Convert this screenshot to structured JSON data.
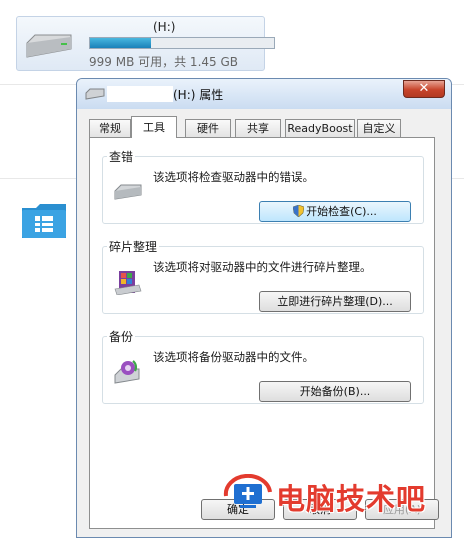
{
  "explorer": {
    "drive_title": "(H:)",
    "drive_capacity": "999 MB 可用，共 1.45 GB",
    "usage_fraction": 0.33
  },
  "dialog": {
    "title": "(H:) 属性",
    "close_label": "✕",
    "tabs": [
      {
        "label": "常规",
        "active": false
      },
      {
        "label": "工具",
        "active": true
      },
      {
        "label": "硬件",
        "active": false
      },
      {
        "label": "共享",
        "active": false
      },
      {
        "label": "ReadyBoost",
        "active": false
      },
      {
        "label": "自定义",
        "active": false
      }
    ],
    "groups": {
      "check": {
        "title": "查错",
        "desc": "该选项将检查驱动器中的错误。",
        "button": "开始检查(C)..."
      },
      "defrag": {
        "title": "碎片整理",
        "desc": "该选项将对驱动器中的文件进行碎片整理。",
        "button": "立即进行碎片整理(D)..."
      },
      "backup": {
        "title": "备份",
        "desc": "该选项将备份驱动器中的文件。",
        "button": "开始备份(B)..."
      }
    },
    "buttons": {
      "ok": "确定",
      "cancel": "取消",
      "apply": "应用(A)"
    }
  },
  "watermark": {
    "text": "电脑技术吧"
  },
  "colors": {
    "accent": "#1a81b9",
    "watermark": "#e33b2e",
    "close": "#c7442b"
  }
}
